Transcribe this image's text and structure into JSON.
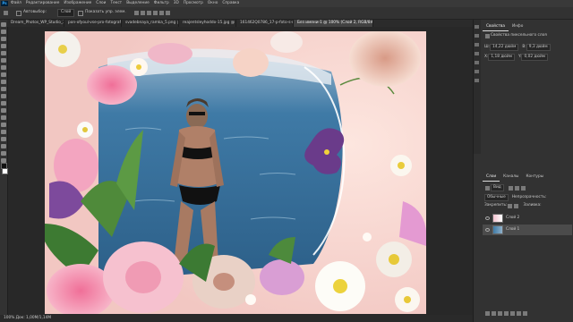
{
  "menubar": {
    "logo": "Ps",
    "items": [
      "Файл",
      "Редактирование",
      "Изображение",
      "Слои",
      "Текст",
      "Выделение",
      "Фильтр",
      "3D",
      "Просмотр",
      "Окно",
      "Справка"
    ]
  },
  "options": {
    "autoselect_label": "Автовыбор:",
    "autoselect_value": "Слой",
    "transform_label": "Показать упр. элем."
  },
  "tabs": [
    {
      "label": "Dream_Photos_WP_Studio_3200x1280_31D3.png @ 100% (Слой 1, RGB/8#)"
    },
    {
      "label": "pon-ofyoul-vse-pro-fotograf..."
    },
    {
      "label": "svadebnaya_ramka_5.png @ 66,7% ..."
    },
    {
      "label": "reajentsleyhoddo-15.jpg @ 50% ..."
    },
    {
      "label": "161462Q0786_17-p-foto-s-ramkami-dlya-fotoshopa-12.png"
    },
    {
      "label": "Без имени-1 @ 100% (Слой 2, RGB/8#)",
      "active": true
    }
  ],
  "status": {
    "text": "100%   Док: 1,00М/1,14М"
  },
  "panel": {
    "tabs_top": [
      "Свойства",
      "Инфо"
    ],
    "prop_title": "Свойства пиксельного слоя",
    "w_label": "Ш:",
    "w_value": "14,22 дюйм",
    "h_label": "В:",
    "h_value": "9,3 дюйм",
    "x_label": "X:",
    "x_value": "1,18 дюйм",
    "y_label": "Y:",
    "y_value": "0,02 дюйм",
    "tabs_layers": [
      "Слои",
      "Каналы",
      "Контуры"
    ],
    "search_label": "Вид",
    "blend_mode": "Обычные",
    "opacity_label": "Непрозрачность:",
    "lock_label": "Закрепить:",
    "fill_label": "Заливка:",
    "layers": [
      {
        "name": "Слой 2",
        "selected": false
      },
      {
        "name": "Слой 1",
        "selected": true
      }
    ]
  },
  "colors": {
    "accent": "#31a8ff",
    "panel_bg": "#323232",
    "canvas_bg": "#282828"
  }
}
